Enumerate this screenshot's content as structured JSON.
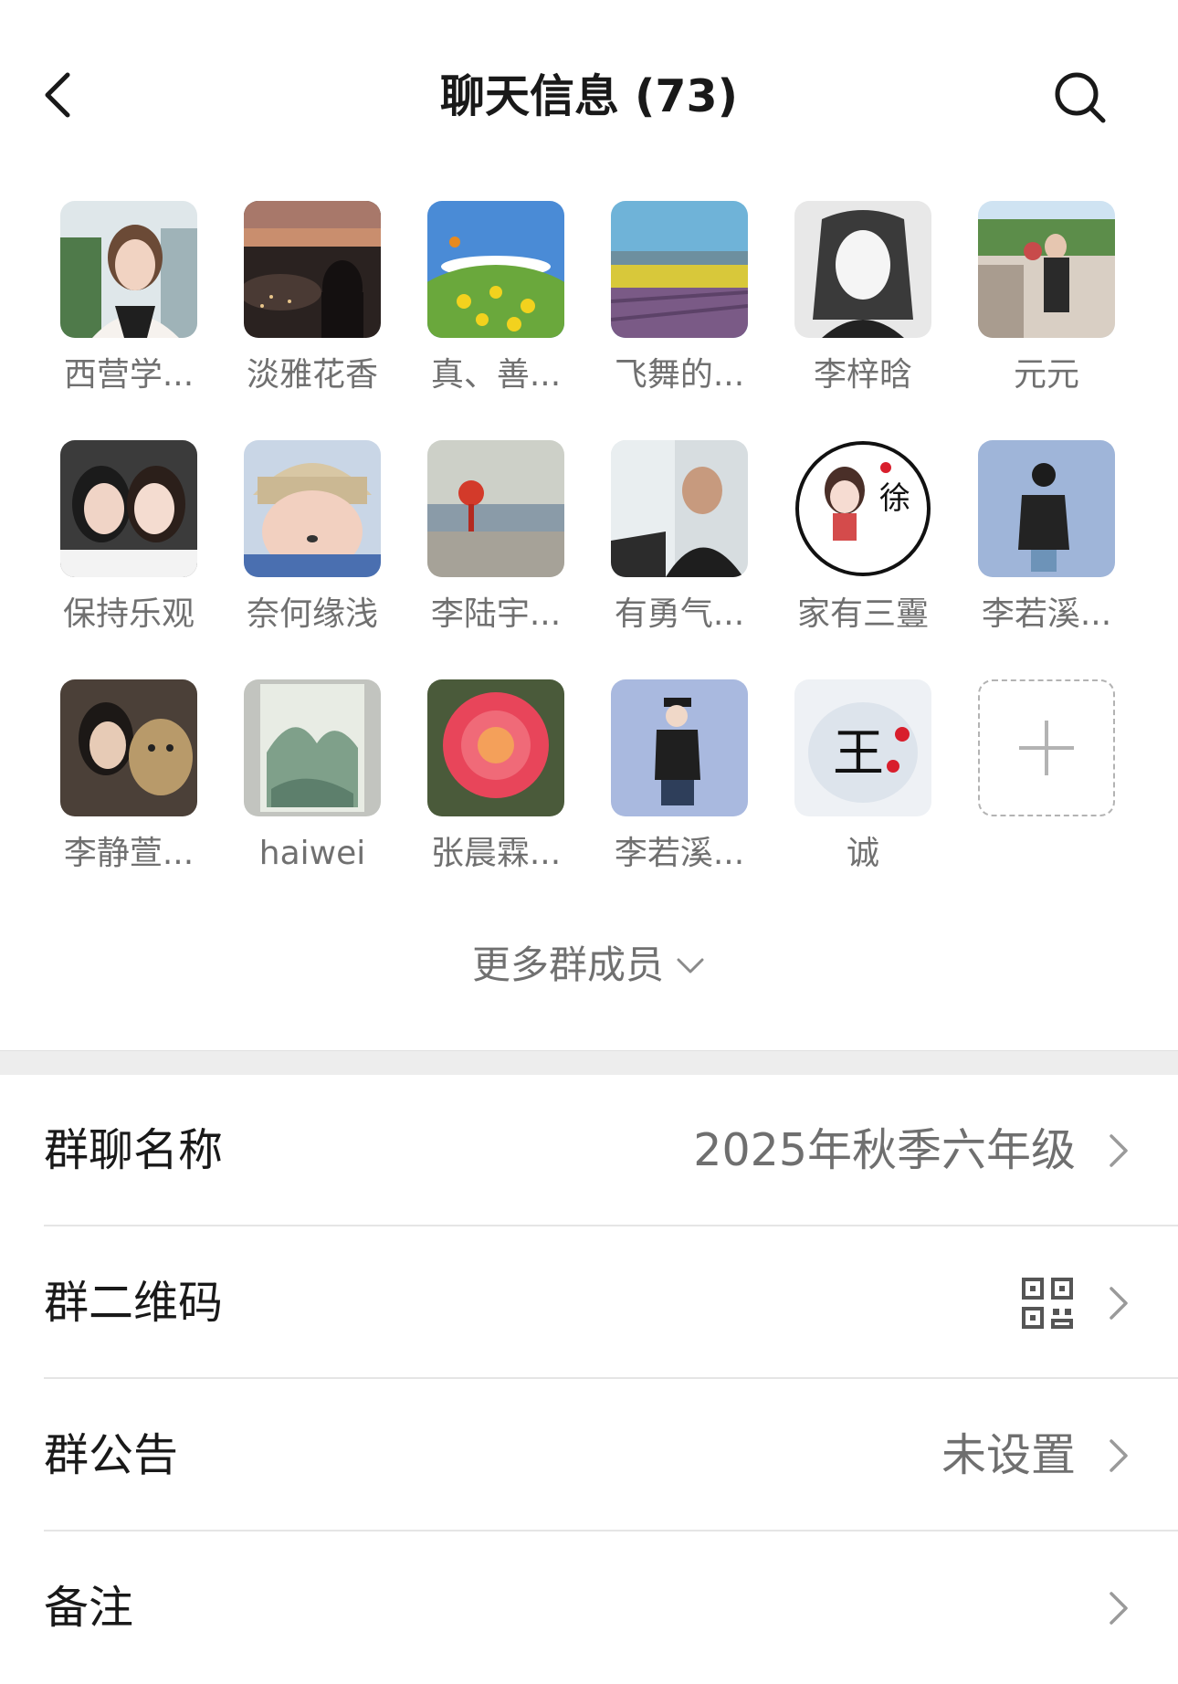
{
  "header": {
    "title": "聊天信息 (73)",
    "back_icon": "chevron-left-icon",
    "search_icon": "search-icon"
  },
  "members": [
    {
      "name": "西营学..."
    },
    {
      "name": "淡雅花香"
    },
    {
      "name": "真、善..."
    },
    {
      "name": "飞舞的..."
    },
    {
      "name": "李梓晗"
    },
    {
      "name": "元元"
    },
    {
      "name": "保持乐观"
    },
    {
      "name": "奈何缘浅"
    },
    {
      "name": "李陆宇..."
    },
    {
      "name": "有勇气..."
    },
    {
      "name": "家有三霻"
    },
    {
      "name": "李若溪..."
    },
    {
      "name": "李静萱..."
    },
    {
      "name": "haiwei"
    },
    {
      "name": "张晨霖..."
    },
    {
      "name": "李若溪..."
    },
    {
      "name": "诚"
    }
  ],
  "add_member_icon": "plus-icon",
  "more_members": {
    "label": "更多群成员",
    "icon": "chevron-down-icon"
  },
  "settings": {
    "group_name": {
      "label": "群聊名称",
      "value": "2025年秋季六年级"
    },
    "group_qr": {
      "label": "群二维码",
      "icon": "qr-code-icon"
    },
    "announcement": {
      "label": "群公告",
      "value": "未设置"
    },
    "remark": {
      "label": "备注"
    }
  },
  "colors": {
    "background": "#ffffff",
    "section_gap": "#ededed",
    "primary_text": "#191919",
    "secondary_text": "#707070",
    "divider": "#e5e5e5"
  }
}
